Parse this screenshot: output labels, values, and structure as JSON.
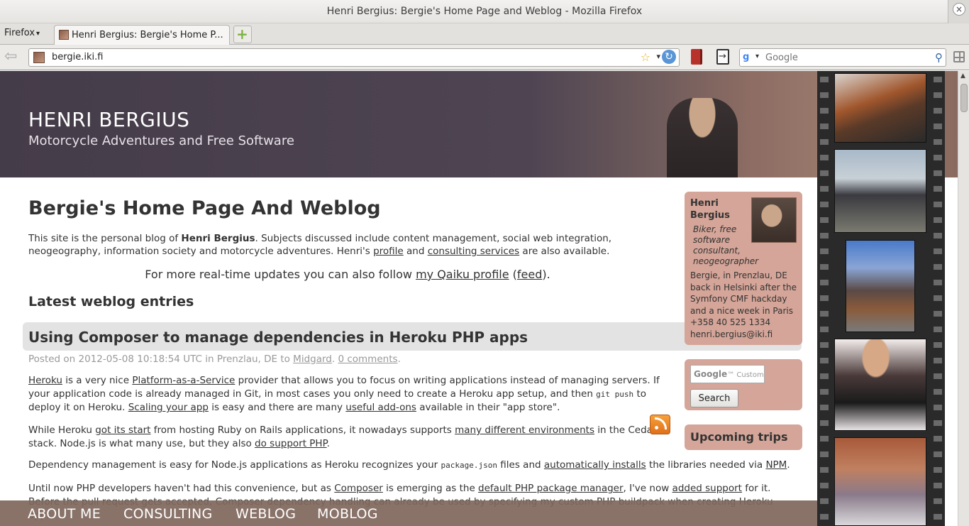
{
  "window": {
    "title": "Henri Bergius: Bergie's Home Page and Weblog - Mozilla Firefox"
  },
  "browser": {
    "menu_label": "Firefox",
    "tab_label": "Henri Bergius: Bergie's Home P...",
    "url": "bergie.iki.fi",
    "search_placeholder": "Google"
  },
  "header": {
    "site_title": "HENRI BERGIUS",
    "tagline": "Motorcycle Adventures and Free Software"
  },
  "main": {
    "heading": "Bergie's Home Page And Weblog",
    "intro": {
      "t1": "This site is the personal blog of ",
      "name": "Henri Bergius",
      "t2": ". Subjects discussed include content management, social web integration, neogeography, information society and motorcycle adventures. Henri's ",
      "profile_link": "profile",
      "t3": " and ",
      "consulting_link": "consulting services",
      "t4": " are also available."
    },
    "qaiku": {
      "t1": "For more real-time updates you can also follow ",
      "profile_link": "my Qaiku profile",
      "t2": " (",
      "feed_link": "feed",
      "t3": ")."
    },
    "latest_heading": "Latest weblog entries"
  },
  "post": {
    "title": "Using Composer to manage dependencies in Heroku PHP apps",
    "meta": {
      "t1": "Posted on 2012-05-08 10:18:54 UTC in Prenzlau, DE to ",
      "category_link": "Midgard",
      "t2": ". ",
      "comments_link": "0 comments",
      "t3": "."
    },
    "p1": {
      "heroku": "Heroku",
      "t1": " is a very nice ",
      "paas": "Platform-as-a-Service",
      "t2": " provider that allows you to focus on writing applications instead of managing servers. If your application code is already managed in Git, in most cases you only need to create a Heroku app setup, and then ",
      "code": "git push",
      "t3": " to deploy it on Heroku. ",
      "scaling": "Scaling your app",
      "t4": " is easy and there are many ",
      "addons": "useful add-ons",
      "t5": " available in their \"app store\"."
    },
    "p2": {
      "t1": "While Heroku ",
      "start": "got its start",
      "t2": " from hosting Ruby on Rails applications, it nowadays supports ",
      "envs": "many different environments",
      "t3": " in the Cedar stack. Node.js is what many use, but they also ",
      "php": "do support PHP",
      "t4": "."
    },
    "p3": {
      "t1": "Dependency management is easy for Node.js applications as Heroku recognizes your ",
      "code": "package.json",
      "t2": " files and ",
      "auto": "automatically installs",
      "t3": " the libraries needed via ",
      "npm": "NPM",
      "t4": "."
    },
    "p4": {
      "t1": "Until now PHP developers haven't had this convenience, but as ",
      "composer": "Composer",
      "t2": " is emerging as the ",
      "pkg": "default PHP package manager",
      "t3": ", I've now ",
      "support": "added support",
      "t4": " for it. Before the pull request gets accepted, Composer dependency handling can already be used by specifying my custom PHP buildpack when creating Heroku apps."
    }
  },
  "sidebar": {
    "profile": {
      "name": "Henri Bergius",
      "bio": "Biker, free software consultant, neogeographer",
      "status": "Bergie, in Prenzlau, DE back in Helsinki after the Symfony CMF hackday and a nice week in Paris",
      "phone": "+358 40 525 1334",
      "email": "henri.bergius@iki.fi"
    },
    "search": {
      "placeholder_brand": "Google",
      "placeholder_text": "Custom Search",
      "button": "Search"
    },
    "trips_heading": "Upcoming trips"
  },
  "nav": {
    "items": [
      "ABOUT ME",
      "CONSULTING",
      "WEBLOG",
      "MOBLOG"
    ]
  },
  "colors": {
    "header_bg": "#453c49",
    "sidebar_box": "#d4a598",
    "nav_bg": "#7f675c",
    "post_title_bg": "#e3e3e3"
  }
}
